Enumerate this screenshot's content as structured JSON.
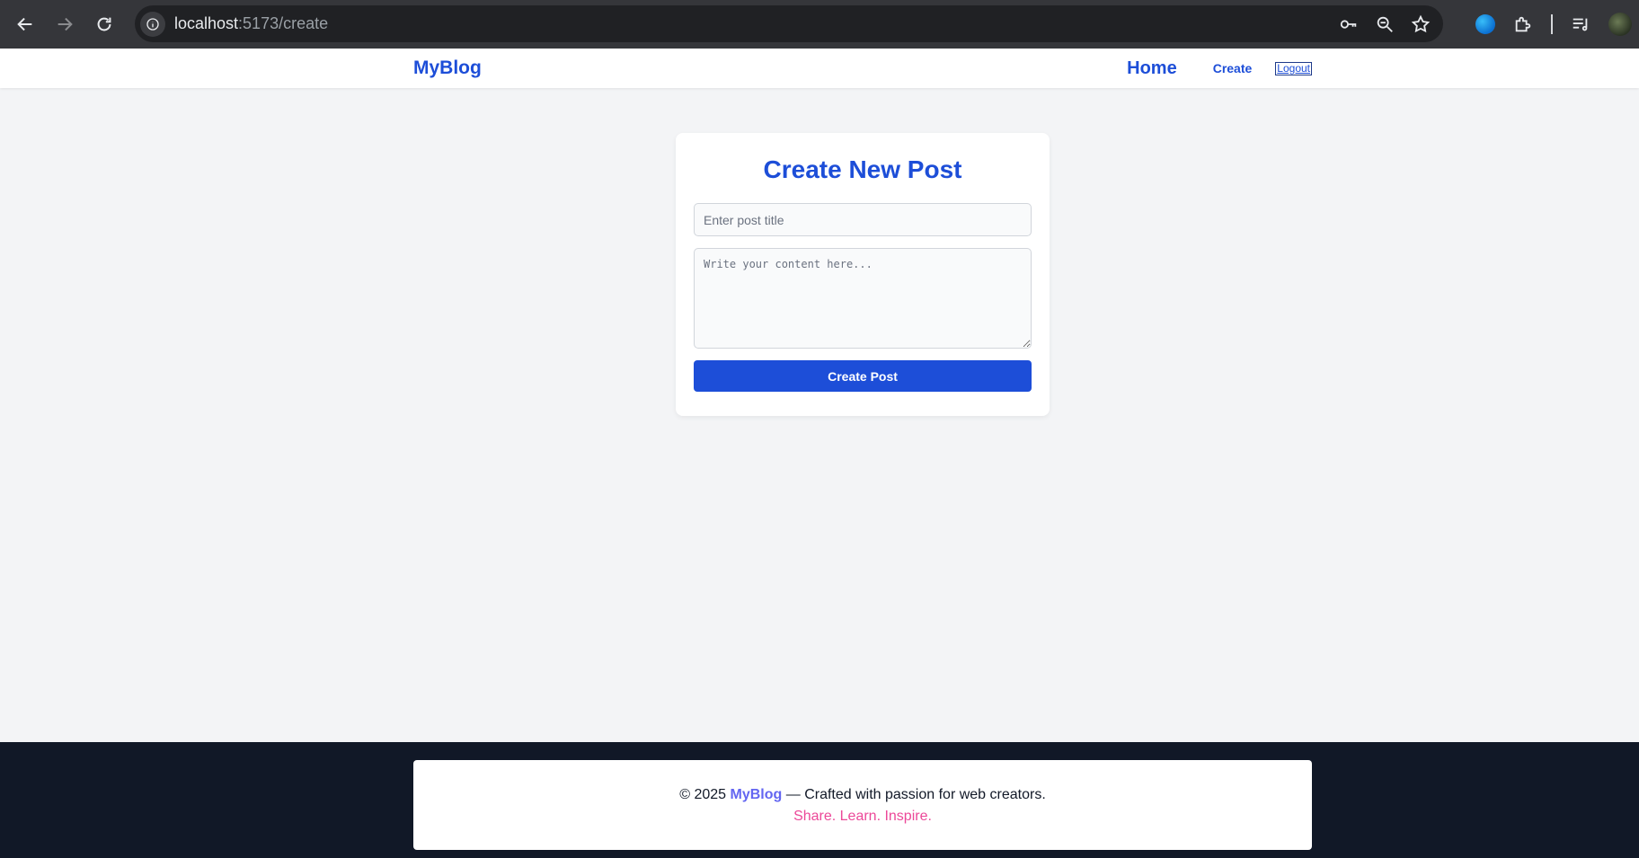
{
  "browser": {
    "url_host": "localhost",
    "url_path": ":5173/create"
  },
  "header": {
    "brand": "MyBlog",
    "nav": {
      "home": "Home",
      "create": "Create",
      "logout": "Logout"
    }
  },
  "form": {
    "heading": "Create New Post",
    "title_placeholder": "Enter post title",
    "title_value": "",
    "content_placeholder": "Write your content here...",
    "content_value": "",
    "submit_label": "Create Post"
  },
  "footer": {
    "copyright": "© 2025",
    "brand": "MyBlog",
    "tagline": "— Crafted with passion for web creators.",
    "slogan": "Share. Learn. Inspire."
  },
  "colors": {
    "accent": "#1d4ed8",
    "footer_bg": "#111827",
    "footer_brand": "#6366f1",
    "slogan": "#ec4899"
  }
}
